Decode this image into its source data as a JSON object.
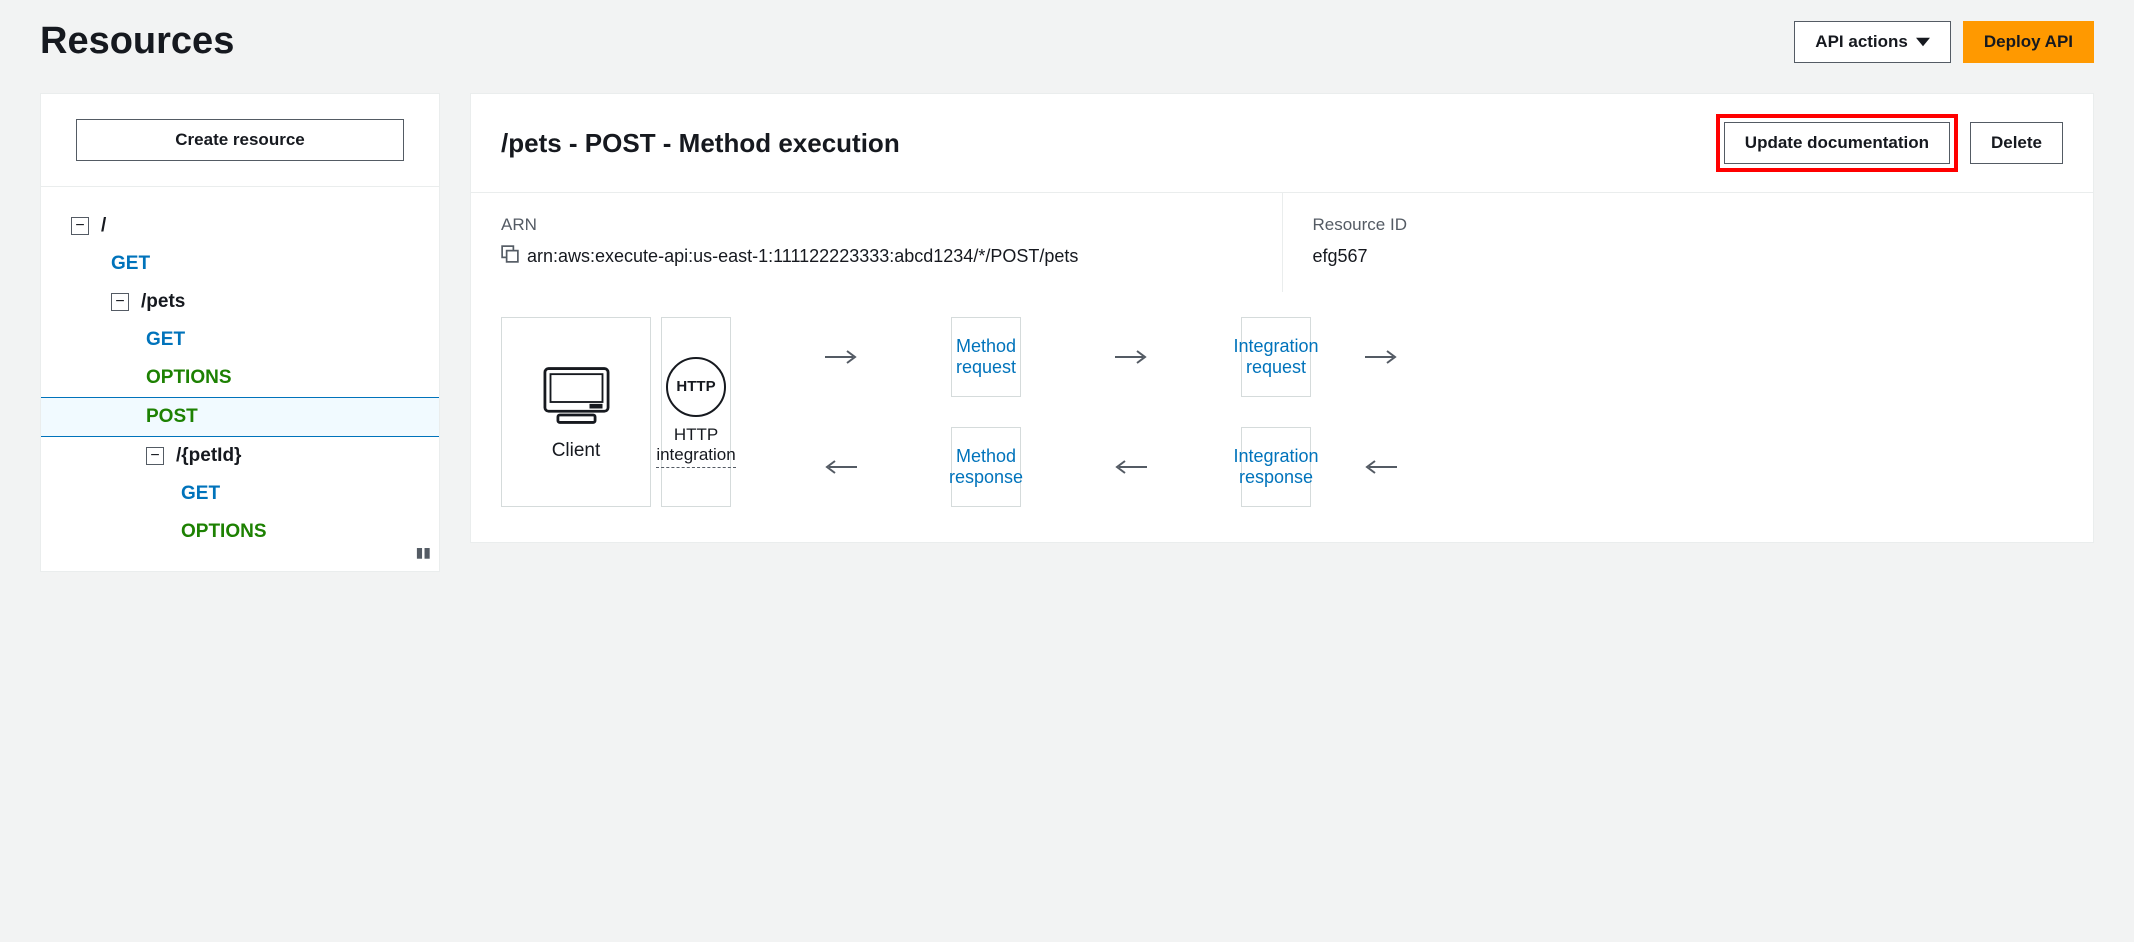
{
  "page_title": "Resources",
  "header_actions": {
    "api_actions_label": "API actions",
    "deploy_label": "Deploy API"
  },
  "sidebar": {
    "create_resource_label": "Create resource",
    "tree": {
      "root": "/",
      "root_methods": [
        "GET"
      ],
      "pets": {
        "label": "/pets",
        "methods": [
          "GET",
          "OPTIONS",
          "POST"
        ],
        "selected": "POST",
        "petId": {
          "label": "/{petId}",
          "methods": [
            "GET",
            "OPTIONS"
          ]
        }
      }
    }
  },
  "main": {
    "title": "/pets - POST - Method execution",
    "update_doc_label": "Update documentation",
    "delete_label": "Delete",
    "info": {
      "arn_label": "ARN",
      "arn_value": "arn:aws:execute-api:us-east-1:111122223333:abcd1234/*/POST/pets",
      "resource_id_label": "Resource ID",
      "resource_id_value": "efg567"
    },
    "flow": {
      "client_label": "Client",
      "method_request": "Method request",
      "integration_request": "Integration request",
      "method_response": "Method response",
      "integration_response": "Integration response",
      "endpoint_badge": "HTTP",
      "endpoint_label": "HTTP integration"
    }
  }
}
